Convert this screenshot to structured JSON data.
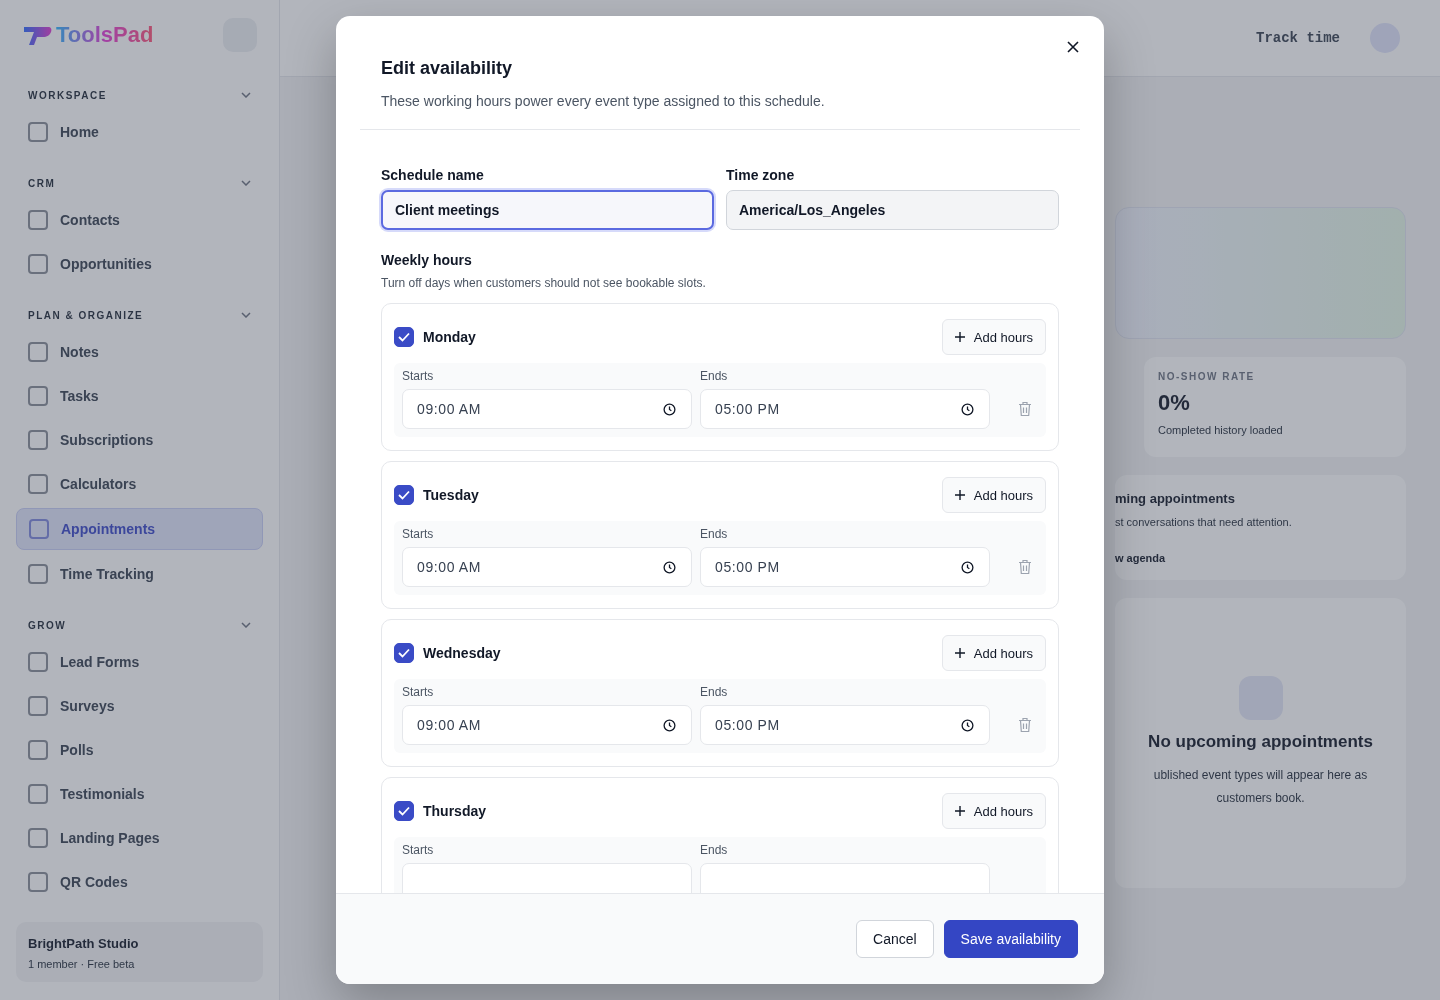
{
  "sidebar": {
    "brand": "ToolsPad",
    "sections": [
      {
        "title": "WORKSPACE",
        "items": [
          {
            "label": "Home",
            "selected": false
          }
        ]
      },
      {
        "title": "CRM",
        "items": [
          {
            "label": "Contacts",
            "selected": false
          },
          {
            "label": "Opportunities",
            "selected": false
          }
        ]
      },
      {
        "title": "PLAN & ORGANIZE",
        "items": [
          {
            "label": "Notes",
            "selected": false
          },
          {
            "label": "Tasks",
            "selected": false
          },
          {
            "label": "Subscriptions",
            "selected": false
          },
          {
            "label": "Calculators",
            "selected": false
          },
          {
            "label": "Appointments",
            "selected": true
          },
          {
            "label": "Time Tracking",
            "selected": false
          }
        ]
      },
      {
        "title": "GROW",
        "items": [
          {
            "label": "Lead Forms",
            "selected": false
          },
          {
            "label": "Surveys",
            "selected": false
          },
          {
            "label": "Polls",
            "selected": false
          },
          {
            "label": "Testimonials",
            "selected": false
          },
          {
            "label": "Landing Pages",
            "selected": false
          },
          {
            "label": "QR Codes",
            "selected": false
          }
        ]
      }
    ],
    "workspace": {
      "name": "BrightPath Studio",
      "meta": "1 member · Free beta"
    }
  },
  "topbar": {
    "track_time": "Track time"
  },
  "background": {
    "stat": {
      "label": "NO-SHOW RATE",
      "value": "0%",
      "note": "Completed history loaded"
    },
    "upcoming": {
      "title": "ming appointments",
      "subtitle": "st conversations that need attention.",
      "link": "w agenda"
    },
    "empty": {
      "title": "No upcoming appointments",
      "text": "ublished event types will appear here as customers book."
    }
  },
  "modal": {
    "title": "Edit availability",
    "subtitle": "These working hours power every event type assigned to this schedule.",
    "schedule_name": {
      "label": "Schedule name",
      "value": "Client meetings",
      "focused": true
    },
    "time_zone": {
      "label": "Time zone",
      "value": "America/Los_Angeles",
      "focused": false
    },
    "weekly": {
      "title": "Weekly hours",
      "hint": "Turn off days when customers should not see bookable slots."
    },
    "days": [
      {
        "name": "Monday",
        "checked": true,
        "add": "Add hours",
        "slots": [
          {
            "starts_label": "Starts",
            "ends_label": "Ends",
            "start": "09:00 AM",
            "end": "05:00 PM"
          }
        ]
      },
      {
        "name": "Tuesday",
        "checked": true,
        "add": "Add hours",
        "slots": [
          {
            "starts_label": "Starts",
            "ends_label": "Ends",
            "start": "09:00 AM",
            "end": "05:00 PM"
          }
        ]
      },
      {
        "name": "Wednesday",
        "checked": true,
        "add": "Add hours",
        "slots": [
          {
            "starts_label": "Starts",
            "ends_label": "Ends",
            "start": "09:00 AM",
            "end": "05:00 PM"
          }
        ]
      },
      {
        "name": "Thursday",
        "checked": true,
        "add": "Add hours",
        "slots": [
          {
            "starts_label": "Starts",
            "ends_label": "Ends"
          }
        ]
      }
    ],
    "buttons": [
      {
        "label": "Cancel",
        "kind": "secondary"
      },
      {
        "label": "Save availability",
        "kind": "primary"
      }
    ]
  }
}
